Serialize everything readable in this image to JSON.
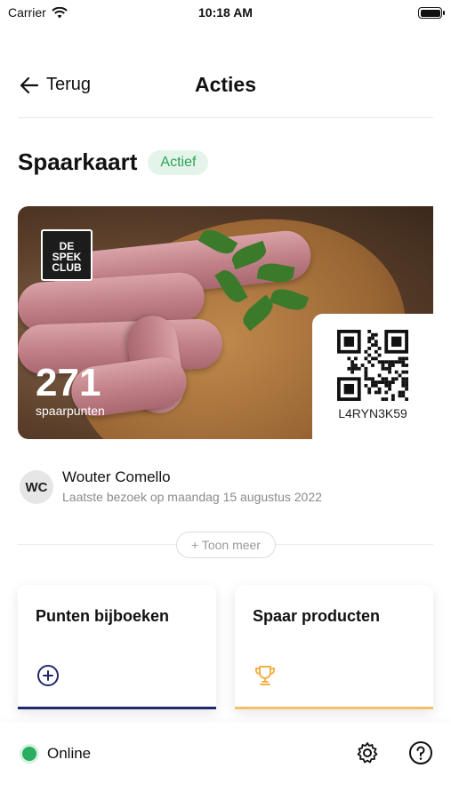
{
  "status": {
    "carrier": "Carrier",
    "time": "10:18 AM"
  },
  "nav": {
    "back_label": "Terug",
    "title": "Acties"
  },
  "card_section": {
    "title": "Spaarkaart",
    "badge": "Actief"
  },
  "card": {
    "brand_lines": [
      "DE",
      "SPEK",
      "CLUB"
    ],
    "points_value": "271",
    "points_label": "spaarpunten",
    "code": "L4RYN3K59"
  },
  "user": {
    "initials": "WC",
    "name": "Wouter Comello",
    "last_visit": "Laatste bezoek op maandag 15 augustus 2022"
  },
  "more": {
    "label": "+ Toon meer"
  },
  "tiles": [
    {
      "title": "Punten bijboeken",
      "icon": "plus-circle-icon",
      "accent": "#1f2a6b"
    },
    {
      "title": "Spaar producten",
      "icon": "trophy-icon",
      "accent": "#f3c068"
    }
  ],
  "footer": {
    "status_label": "Online",
    "status_color": "#27ae60"
  },
  "colors": {
    "badge_bg": "#e5f4ea",
    "badge_text": "#2aa457"
  }
}
